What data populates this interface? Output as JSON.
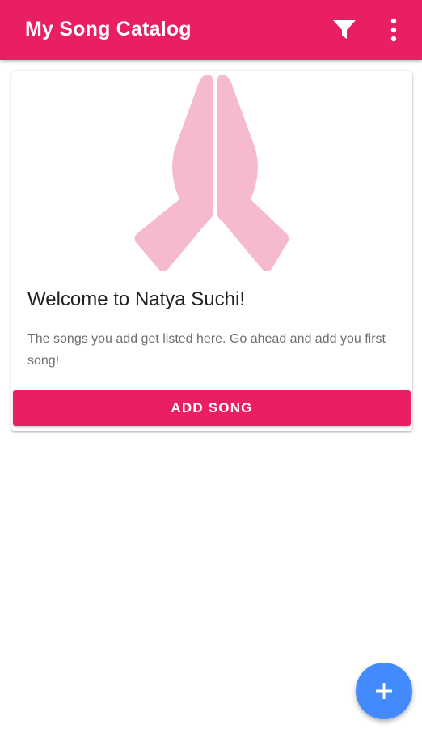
{
  "appbar": {
    "title": "My Song Catalog",
    "background_color": "#e91e63",
    "actions": [
      {
        "icon": "filter-icon"
      },
      {
        "icon": "more-vert-icon"
      }
    ]
  },
  "welcome_card": {
    "illustration_icon": "praying-hands-icon",
    "illustration_color": "#f5bacd",
    "title": "Welcome to Natya Suchi!",
    "body": "The songs you add get listed here. Go ahead and add you first song!",
    "button_label": "ADD SONG",
    "button_color": "#e91e63"
  },
  "fab": {
    "icon": "plus-icon",
    "color": "#448aff"
  }
}
